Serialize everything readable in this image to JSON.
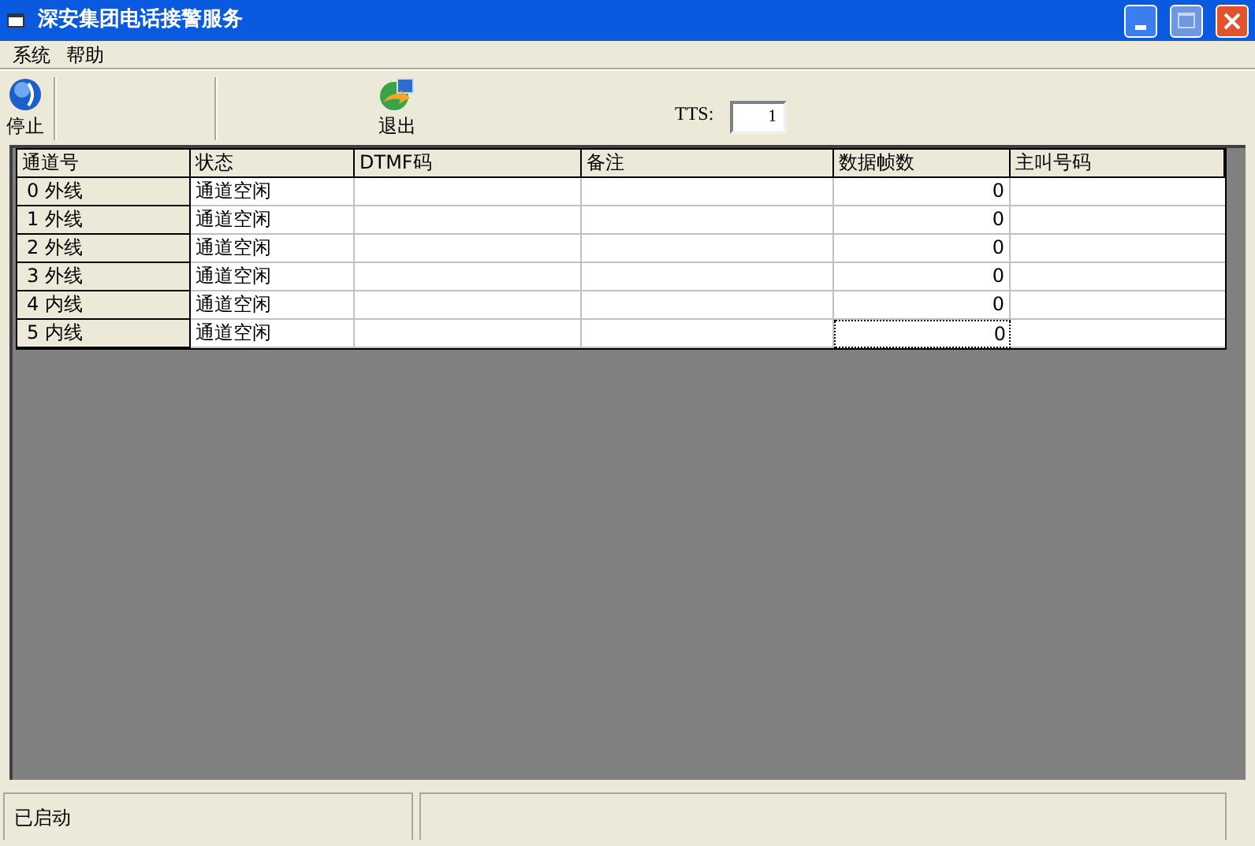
{
  "window": {
    "title": "深安集团电话接警服务"
  },
  "menu": [
    "系统",
    "帮助"
  ],
  "toolbar": [
    {
      "label": "停止",
      "kind": "stop"
    },
    {
      "label": "退出",
      "kind": "exit"
    }
  ],
  "tts": {
    "label": "TTS:",
    "value": "1"
  },
  "table": {
    "columns": [
      "通道号",
      "状态",
      "DTMF码",
      "备注",
      "数据帧数",
      "主叫号码"
    ],
    "rows": [
      {
        "channel": "0 外线",
        "status": "通道空闲",
        "frames": "0",
        "focused": false
      },
      {
        "channel": "1 外线",
        "status": "通道空闲",
        "frames": "0",
        "focused": false
      },
      {
        "channel": "2 外线",
        "status": "通道空闲",
        "frames": "0",
        "focused": false
      },
      {
        "channel": "3 外线",
        "status": "通道空闲",
        "frames": "0",
        "focused": false
      },
      {
        "channel": "4 内线",
        "status": "通道空闲",
        "frames": "0",
        "focused": false
      },
      {
        "channel": "5 内线",
        "status": "通道空闲",
        "frames": "0",
        "focused": true
      }
    ]
  },
  "status_bar": [
    "已启动"
  ]
}
